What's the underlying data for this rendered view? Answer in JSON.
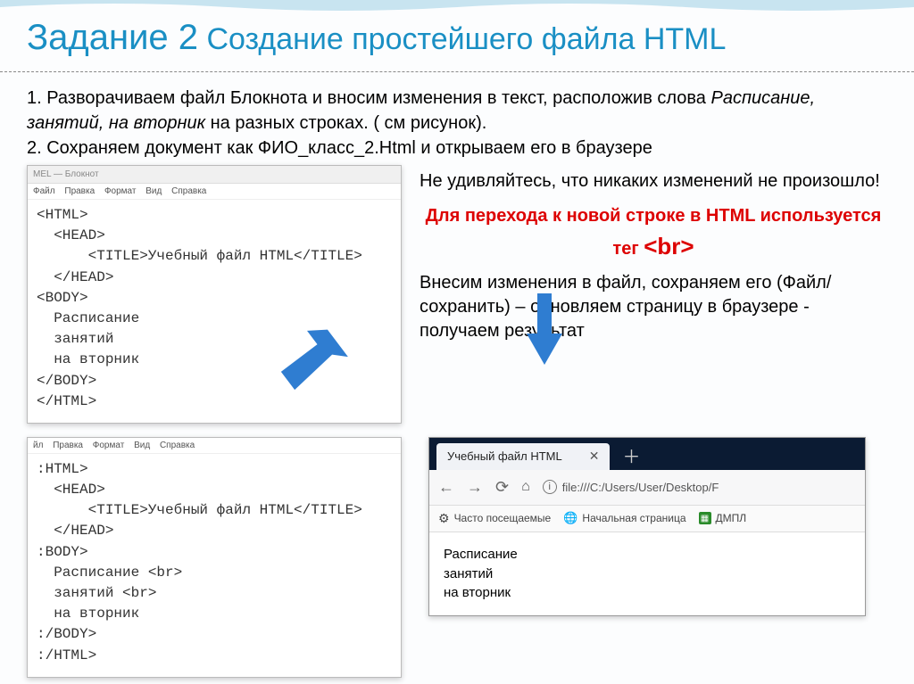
{
  "title": {
    "big": "Задание 2",
    "rest": " Создание простейшего файла HTML"
  },
  "instr": {
    "line1_a": "1. Разворачиваем файл Блокнота и вносим изменения в текст, расположив слова ",
    "line1_italic": "Расписание, занятий, на вторник",
    "line1_b": " на разных строках. ( см рисунок).",
    "line2": "2. Сохраняем документ как ФИО_класс_2.Html и открываем его в браузере"
  },
  "notepad1": {
    "title": "MEL — Блокнот",
    "menu": {
      "file": "Файл",
      "edit": "Правка",
      "format": "Формат",
      "view": "Вид",
      "help": "Справка"
    },
    "code": "<HTML>\n  <HEAD>\n      <TITLE>Учебный файл HTML</TITLE>\n  </HEAD>\n<BODY>\n  Расписание\n  занятий\n  на вторник\n</BODY>\n</HTML>"
  },
  "right": {
    "p1": "Не удивляйтесь, что никаких изменений не произошло!",
    "red_a": "Для перехода к новой строке в HTML используется тег ",
    "red_tag": "<br>",
    "p2": "Внесим изменения в файл, сохраняем его (Файл/сохранить) – обновляем страницу в браузере - получаем результат"
  },
  "notepad2": {
    "menu": {
      "file": "йл",
      "edit": "Правка",
      "format": "Формат",
      "view": "Вид",
      "help": "Справка"
    },
    "code": ":HTML>\n  <HEAD>\n      <TITLE>Учебный файл HTML</TITLE>\n  </HEAD>\n:BODY>\n  Расписание <br>\n  занятий <br>\n  на вторник\n:/BODY>\n:/HTML>"
  },
  "browser": {
    "tab_title": "Учебный файл HTML",
    "url": "file:///C:/Users/User/Desktop/F",
    "bookmarks": {
      "b1": "Часто посещаемые",
      "b2": "Начальная страница",
      "b3": "ДМПЛ"
    },
    "body": "Расписание\nзанятий\nна вторник"
  }
}
